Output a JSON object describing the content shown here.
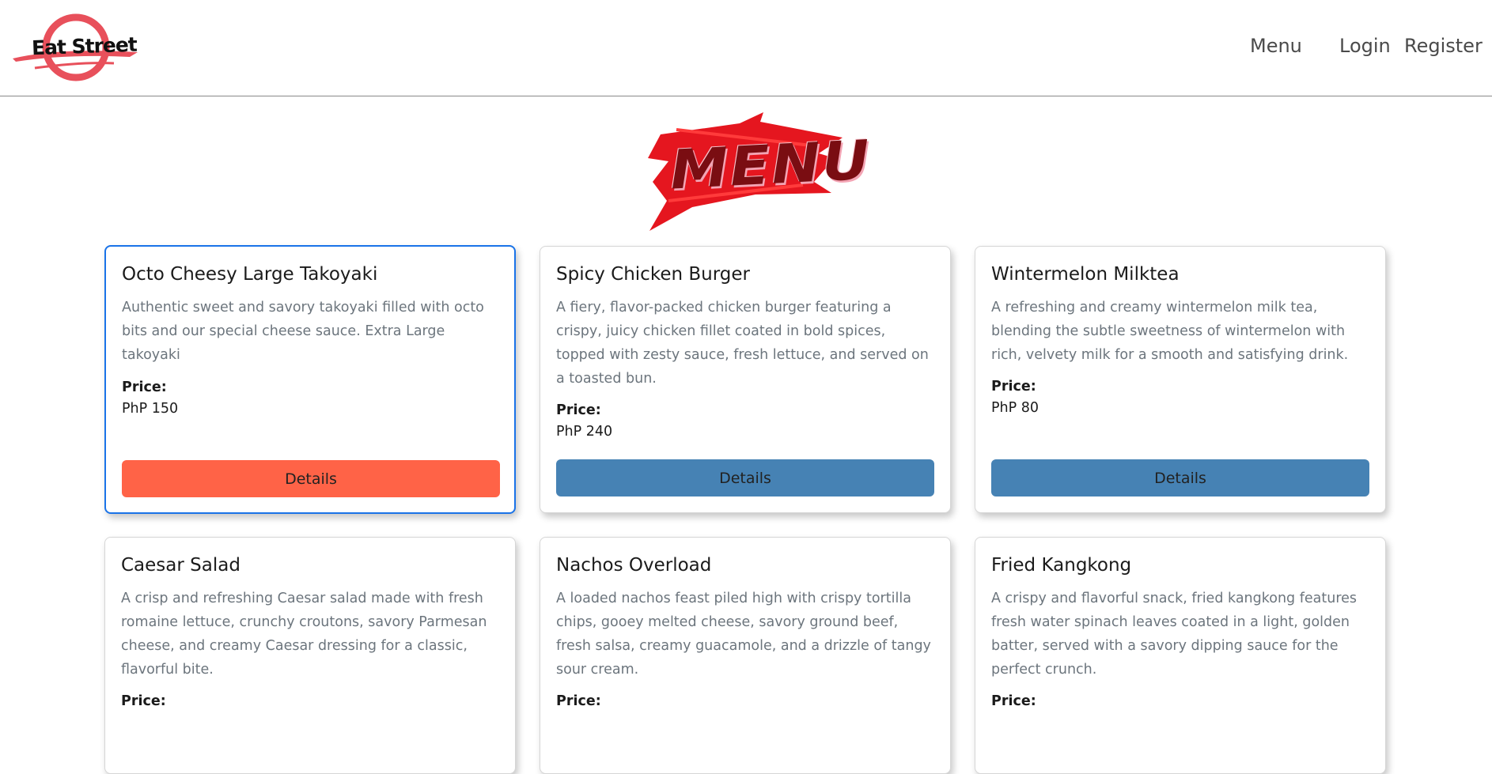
{
  "nav": {
    "logo_text": "Eat Street",
    "links": [
      "Menu",
      "Login",
      "Register"
    ]
  },
  "banner": {
    "text": "MENU"
  },
  "colors": {
    "button_default": "#4682b4",
    "button_active": "#ff6347",
    "selected_border": "#1a73e8"
  },
  "price_label": "Price:",
  "button_label": "Details",
  "items": [
    {
      "name": "Octo Cheesy Large Takoyaki",
      "description": "Authentic sweet and savory takoyaki filled with octo bits and our special cheese sauce. Extra Large takoyaki",
      "price": "PhP 150"
    },
    {
      "name": "Spicy Chicken Burger",
      "description": "A fiery, flavor-packed chicken burger featuring a crispy, juicy chicken fillet coated in bold spices, topped with zesty sauce, fresh lettuce, and served on a toasted bun.",
      "price": "PhP 240"
    },
    {
      "name": "Wintermelon Milktea",
      "description": "A refreshing and creamy wintermelon milk tea, blending the subtle sweetness of wintermelon with rich, velvety milk for a smooth and satisfying drink.",
      "price": "PhP 80"
    },
    {
      "name": "Caesar Salad",
      "description": "A crisp and refreshing Caesar salad made with fresh romaine lettuce, crunchy croutons, savory Parmesan cheese, and creamy Caesar dressing for a classic, flavorful bite."
    },
    {
      "name": "Nachos Overload",
      "description": "A loaded nachos feast piled high with crispy tortilla chips, gooey melted cheese, savory ground beef, fresh salsa, creamy guacamole, and a drizzle of tangy sour cream."
    },
    {
      "name": "Fried Kangkong",
      "description": "A crispy and flavorful snack, fried kangkong features fresh water spinach leaves coated in a light, golden batter, served with a savory dipping sauce for the perfect crunch."
    }
  ]
}
